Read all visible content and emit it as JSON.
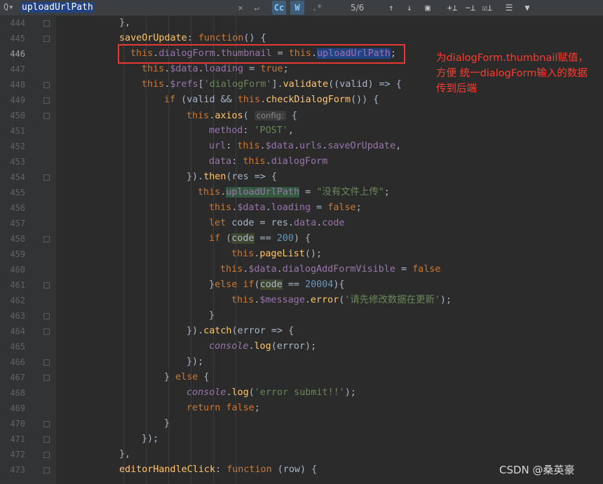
{
  "search": {
    "query": "uploadUrlPath",
    "match_count": "5/6",
    "toggles": {
      "case": "Cc",
      "words": "W",
      "regex": ".*"
    }
  },
  "lines": [
    {
      "n": "444",
      "indent": 160,
      "fold": true,
      "html": "},"
    },
    {
      "n": "445",
      "indent": 160,
      "fold": true,
      "html": "<span class='fn'>saveOrUpdate</span>: <span class='kw'>function</span>() {"
    },
    {
      "n": "446",
      "indent": 176,
      "fold": false,
      "cur": true,
      "html": "<span class='kw'>this</span>.<span class='prop'>dialogForm</span>.<span class='prop'>thumbnail</span> = <span class='kw'>this</span>.<span class='prop hl-sel'>uploadUrlPath</span>;"
    },
    {
      "n": "447",
      "indent": 192,
      "fold": false,
      "html": "<span class='kw'>this</span>.<span class='prop'>$data</span>.<span class='prop'>loading</span> = <span class='kw'>true</span>;"
    },
    {
      "n": "448",
      "indent": 192,
      "fold": true,
      "html": "<span class='kw'>this</span>.<span class='prop'>$refs</span>[<span class='str'>'dialogForm'</span>].<span class='fn'>validate</span>((valid) => {"
    },
    {
      "n": "449",
      "indent": 224,
      "fold": true,
      "html": "<span class='kw'>if</span> (valid &amp;&amp; <span class='kw'>this</span>.<span class='fn'>checkDialogForm</span>()) {"
    },
    {
      "n": "450",
      "indent": 256,
      "fold": true,
      "html": "<span class='kw'>this</span>.<span class='fn'>axios</span>( <span class='hint'>config:</span> {"
    },
    {
      "n": "451",
      "indent": 288,
      "fold": false,
      "html": "<span class='prop'>method</span>: <span class='str'>'POST'</span>,"
    },
    {
      "n": "452",
      "indent": 288,
      "fold": false,
      "html": "<span class='prop'>url</span>: <span class='kw'>this</span>.<span class='prop'>$data</span>.<span class='prop'>urls</span>.<span class='prop'>saveOrUpdate</span>,"
    },
    {
      "n": "453",
      "indent": 288,
      "fold": false,
      "html": "<span class='prop'>data</span>: <span class='kw'>this</span>.<span class='prop'>dialogForm</span>"
    },
    {
      "n": "454",
      "indent": 256,
      "fold": true,
      "html": "}).<span class='fn'>then</span>(res => {"
    },
    {
      "n": "455",
      "indent": 272,
      "fold": false,
      "html": "<span class='kw'>this</span>.<span class='prop hl-match'>uploadUrlPath</span> = <span class='str'>\"没有文件上传\"</span>;"
    },
    {
      "n": "456",
      "indent": 288,
      "fold": false,
      "html": "<span class='kw'>this</span>.<span class='prop'>$data</span>.<span class='prop'>loading</span> = <span class='kw'>false</span>;"
    },
    {
      "n": "457",
      "indent": 288,
      "fold": false,
      "html": "<span class='kw'>let</span> code = res.<span class='prop'>data</span>.<span class='prop'>code</span>"
    },
    {
      "n": "458",
      "indent": 288,
      "fold": true,
      "html": "<span class='kw'>if</span> (<span class='hl-read'>code</span> == <span class='num'>200</span>) {"
    },
    {
      "n": "459",
      "indent": 320,
      "fold": false,
      "html": "<span class='kw'>this</span>.<span class='fn'>pageList</span>();"
    },
    {
      "n": "460",
      "indent": 304,
      "fold": false,
      "html": "<span class='kw'>this</span>.<span class='prop'>$data</span>.<span class='prop'>dialogAddFormVisible</span> = <span class='kw'>false</span>"
    },
    {
      "n": "461",
      "indent": 288,
      "fold": true,
      "html": "}<span class='kw'>else if</span>(<span class='hl-read'>code</span> == <span class='num'>20004</span>){"
    },
    {
      "n": "462",
      "indent": 320,
      "fold": false,
      "html": "<span class='kw'>this</span>.<span class='prop'>$message</span>.<span class='fn'>error</span>(<span class='str'>'请先修改数据在更新'</span>);"
    },
    {
      "n": "463",
      "indent": 288,
      "fold": true,
      "html": "}"
    },
    {
      "n": "464",
      "indent": 256,
      "fold": true,
      "html": "}).<span class='fn'>catch</span>(error => {"
    },
    {
      "n": "465",
      "indent": 288,
      "fold": false,
      "html": "<span class='it'>console</span>.<span class='fn'>log</span>(error);"
    },
    {
      "n": "466",
      "indent": 256,
      "fold": true,
      "html": "});"
    },
    {
      "n": "467",
      "indent": 224,
      "fold": true,
      "html": "} <span class='kw'>else</span> {"
    },
    {
      "n": "468",
      "indent": 256,
      "fold": false,
      "html": "<span class='it'>console</span>.<span class='fn'>log</span>(<span class='str'>'error submit!!'</span>);"
    },
    {
      "n": "469",
      "indent": 256,
      "fold": false,
      "html": "<span class='kw'>return false</span>;"
    },
    {
      "n": "470",
      "indent": 224,
      "fold": true,
      "html": "}"
    },
    {
      "n": "471",
      "indent": 192,
      "fold": true,
      "html": "});"
    },
    {
      "n": "472",
      "indent": 160,
      "fold": true,
      "html": "},"
    },
    {
      "n": "473",
      "indent": 160,
      "fold": true,
      "html": "<span class='fn'>editorHandleClick</span>: <span class='kw'>function</span> (row) {"
    }
  ],
  "annotation": "为dialogForm.thumbnail赋值，方便 统一dialogForm输入的数据传到后端",
  "watermark": "CSDN @桑英豪",
  "colors": {
    "selection": "#214283",
    "annotation_red": "#ff3b30",
    "box_red": "#e53935"
  }
}
